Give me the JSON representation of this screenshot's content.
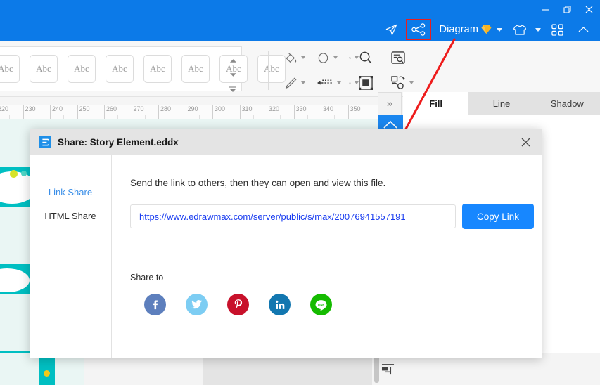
{
  "window": {
    "controls": [
      {
        "name": "minimize",
        "glyph": "minimize-icon"
      },
      {
        "name": "restore",
        "glyph": "restore-icon"
      },
      {
        "name": "close",
        "glyph": "close-icon"
      }
    ]
  },
  "titlebar": {
    "send_icon": "send-icon",
    "share_icon": "share-icon",
    "diagram_label": "Diagram",
    "gem_icon": "diamond-badge-icon",
    "theme_icon": "shirt-icon",
    "grid_icon": "grid-apps-icon",
    "collapse_icon": "chevron-up-icon",
    "accent": "#0c7ae8",
    "highlight_color": "#e81f1f"
  },
  "ribbon": {
    "style_cells": [
      "Abc",
      "Abc",
      "Abc",
      "Abc",
      "Abc",
      "Abc",
      "Abc",
      "Abc"
    ],
    "scroll_up": "scroll-up-icon",
    "scroll_down": "scroll-down-icon",
    "scroll_expand": "scroll-expand-icon",
    "tools": [
      {
        "name": "fill-color-tool",
        "icon": "paint-bucket-icon",
        "caret": true
      },
      {
        "name": "shape-tool",
        "icon": "ellipse-shape-icon",
        "caret": true
      },
      {
        "name": "crop-tool",
        "icon": "crop-icon",
        "caret": true
      },
      {
        "name": "zoom-tool",
        "icon": "magnifier-icon",
        "caret": false
      },
      {
        "name": "find-replace-tool",
        "icon": "document-search-icon",
        "caret": false
      },
      {
        "name": "pen-tool",
        "icon": "pen-icon",
        "caret": true
      },
      {
        "name": "line-style-tool",
        "icon": "dashed-arrow-icon",
        "caret": true
      },
      {
        "name": "lock-tool",
        "icon": "lock-icon",
        "caret": true
      },
      {
        "name": "select-area-tool",
        "icon": "select-frame-icon",
        "caret": false
      },
      {
        "name": "replace-shape-tool",
        "icon": "shape-replace-icon",
        "caret": true
      }
    ]
  },
  "format_panel": {
    "collapse_label": "»",
    "tabs": [
      {
        "label": "Fill",
        "active": true
      },
      {
        "label": "Line",
        "active": false
      },
      {
        "label": "Shadow",
        "active": false
      }
    ]
  },
  "ruler": {
    "labels": [
      "220",
      "230",
      "240",
      "250",
      "260",
      "270",
      "280",
      "290",
      "300",
      "310",
      "320",
      "330",
      "340",
      "350"
    ]
  },
  "dialog": {
    "title": "Share: Story Element.eddx",
    "app_icon": "edraw-logo-icon",
    "close_icon": "close-icon",
    "sidebar": [
      {
        "label": "Link Share",
        "active": true
      },
      {
        "label": "HTML Share",
        "active": false
      }
    ],
    "description": "Send the link to others, then they can open and view this file.",
    "link_url": "https://www.edrawmax.com/server/public/s/max/20076941557191",
    "copy_label": "Copy Link",
    "share_to_label": "Share to",
    "socials": [
      {
        "name": "facebook",
        "color": "#5d7fbd",
        "glyph": "f"
      },
      {
        "name": "twitter",
        "color": "#7dcdf3",
        "glyph": "twitter-bird-icon"
      },
      {
        "name": "pinterest",
        "color": "#c8112b",
        "glyph": "P"
      },
      {
        "name": "linkedin",
        "color": "#1277b0",
        "glyph": "in"
      },
      {
        "name": "line",
        "color": "#15bb00",
        "glyph": "LINE"
      }
    ]
  },
  "statusbar": {
    "layout_icon": "page-layout-icon"
  }
}
